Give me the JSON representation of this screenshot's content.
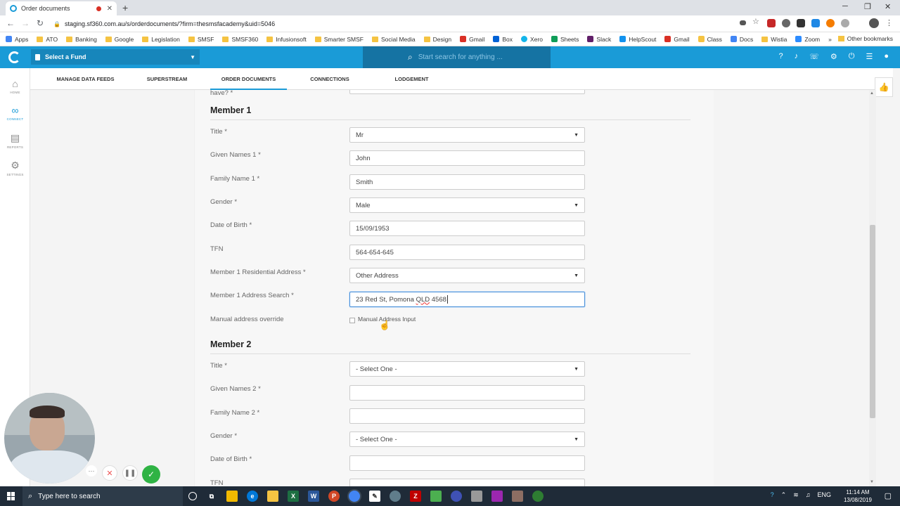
{
  "browser": {
    "tab_title": "Order documents",
    "new_tab": "+",
    "url": "staging.sf360.com.au/s/orderdocuments/?firm=thesmsfacademy&uid=5046",
    "bookmarks": [
      "Apps",
      "ATO",
      "Banking",
      "Google",
      "Legislation",
      "SMSF",
      "SMSF360",
      "Infusionsoft",
      "Smarter SMSF",
      "Social Media",
      "Design",
      "Gmail",
      "Box",
      "Xero",
      "Sheets",
      "Slack",
      "HelpScout",
      "Gmail",
      "Class",
      "Docs",
      "Wistia",
      "Zoom",
      "»"
    ],
    "other_bookmarks": "Other bookmarks"
  },
  "app": {
    "fund_selector": "Select a Fund",
    "search_placeholder": "Start search for anything ..."
  },
  "subnav": [
    "MANAGE DATA FEEDS",
    "SUPERSTREAM",
    "ORDER DOCUMENTS",
    "CONNECTIONS",
    "LODGEMENT"
  ],
  "rail": [
    {
      "label": "HOME",
      "icon": "home-icon"
    },
    {
      "label": "CONNECT",
      "icon": "connect-icon"
    },
    {
      "label": "REPORTS",
      "icon": "reports-icon"
    },
    {
      "label": "SETTINGS",
      "icon": "settings-icon"
    }
  ],
  "form": {
    "cut_label": "have? *",
    "member1": {
      "heading": "Member 1",
      "title_label": "Title *",
      "title_value": "Mr",
      "given_label": "Given Names 1 *",
      "given_value": "John",
      "family_label": "Family Name 1 *",
      "family_value": "Smith",
      "gender_label": "Gender *",
      "gender_value": "Male",
      "dob_label": "Date of Birth *",
      "dob_value": "15/09/1953",
      "tfn_label": "TFN",
      "tfn_value": "564-654-645",
      "res_label": "Member 1 Residential Address *",
      "res_value": "Other Address",
      "addr_label": "Member 1 Address Search *",
      "addr_value_a": "23 Red St, Pomona ",
      "addr_value_b": "QLD",
      "addr_value_c": " 4568",
      "manual_label": "Manual address override",
      "manual_checkbox": "Manual Address Input"
    },
    "member2": {
      "heading": "Member 2",
      "title_label": "Title *",
      "title_value": "- Select One -",
      "given_label": "Given Names 2 *",
      "family_label": "Family Name 2 *",
      "gender_label": "Gender *",
      "gender_value": "- Select One -",
      "dob_label": "Date of Birth *",
      "tfn_label": "TFN"
    }
  },
  "taskbar": {
    "search": "Type here to search",
    "lang": "ENG",
    "time": "11:14 AM",
    "date": "13/08/2019"
  },
  "colors": {
    "brand": "#1a9bd7",
    "header_search": "#1573a3"
  }
}
